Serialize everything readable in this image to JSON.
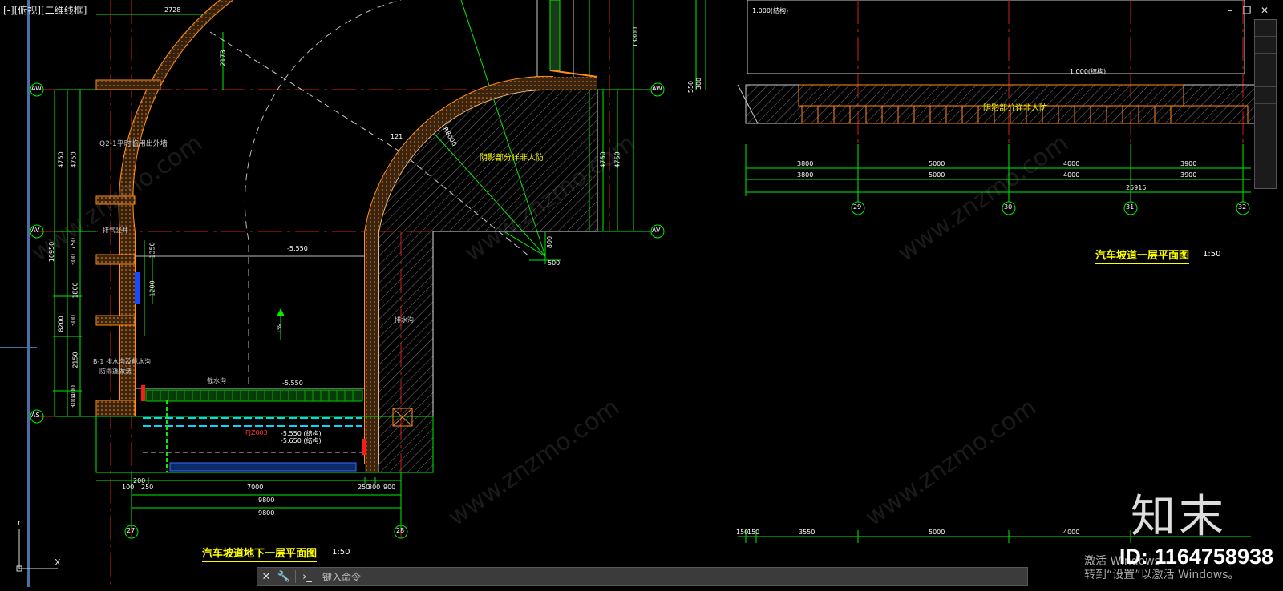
{
  "viewport": {
    "label": "[-][俯视][二维线框]"
  },
  "window_controls": {
    "minimize": "–",
    "restore": "❐",
    "close": "✕"
  },
  "grid_bubbles": {
    "left_rows": [
      "AW",
      "AV",
      "AS"
    ],
    "right_rows": [
      "AW",
      "AV"
    ],
    "left_cols": [
      "27",
      "28"
    ],
    "right_cols": [
      "29",
      "30",
      "31",
      "32"
    ]
  },
  "drawing_left": {
    "title": "汽车坡道地下一层平面图",
    "scale": "1:50",
    "dims_bottom": [
      "100",
      "200",
      "250",
      "7000",
      "250",
      "300",
      "900"
    ],
    "dims_totals": [
      "9800",
      "9800"
    ],
    "dims_top": [
      "2728",
      "2173",
      "121"
    ],
    "dims_left": [
      "4750",
      "4750",
      "10950",
      "8200",
      "750",
      "300",
      "1800",
      "300",
      "2150",
      "300",
      "400"
    ],
    "dims_right": [
      "4750",
      "4750",
      "13800",
      "550",
      "300",
      "800",
      "500",
      "1350",
      "1200"
    ],
    "labels": {
      "shaded_note": "阴影部分详非人防",
      "wall_note": "Q2-1平时临用出外墙",
      "side_note": "B-1 排水沟及截水沟",
      "side_note2": "防雨篷做法",
      "vent": "排气竖井",
      "level_a": "-5.550",
      "level_b": "-5.550",
      "level_c": "-5.550 (结构)",
      "level_d": "-5.650 (结构)",
      "fire_door": "FJZ003",
      "gate": "截水沟",
      "radius": "R8000",
      "slope": "1%",
      "drain": "排水沟"
    }
  },
  "drawing_right": {
    "title": "汽车坡道一层平面图",
    "scale": "1:50",
    "shaded_note": "阴影部分详非人防",
    "dims_row1": [
      "3800",
      "5000",
      "4000",
      "3900"
    ],
    "dims_row2": [
      "3800",
      "5000",
      "4000",
      "3900"
    ],
    "dims_total": "25915",
    "dims_bottom": [
      "150",
      "150",
      "3550",
      "5000",
      "4000"
    ],
    "levels": [
      "1.000(结构)",
      "1.000(结构)"
    ]
  },
  "command_line": {
    "placeholder": "键入命令"
  },
  "watermark": {
    "logo": "知末",
    "id": "ID: 1164758938",
    "site": "www.znzmo.com"
  },
  "os_notice": {
    "line1": "激活 Windows",
    "line2": "转到“设置”以激活 Windows。"
  },
  "colors": {
    "background": "#000000",
    "axis": "#ff3030",
    "dim": "#00ff00",
    "wall": "#ff8c1a",
    "text_yellow": "#ffff00",
    "hatch": "#666666"
  }
}
